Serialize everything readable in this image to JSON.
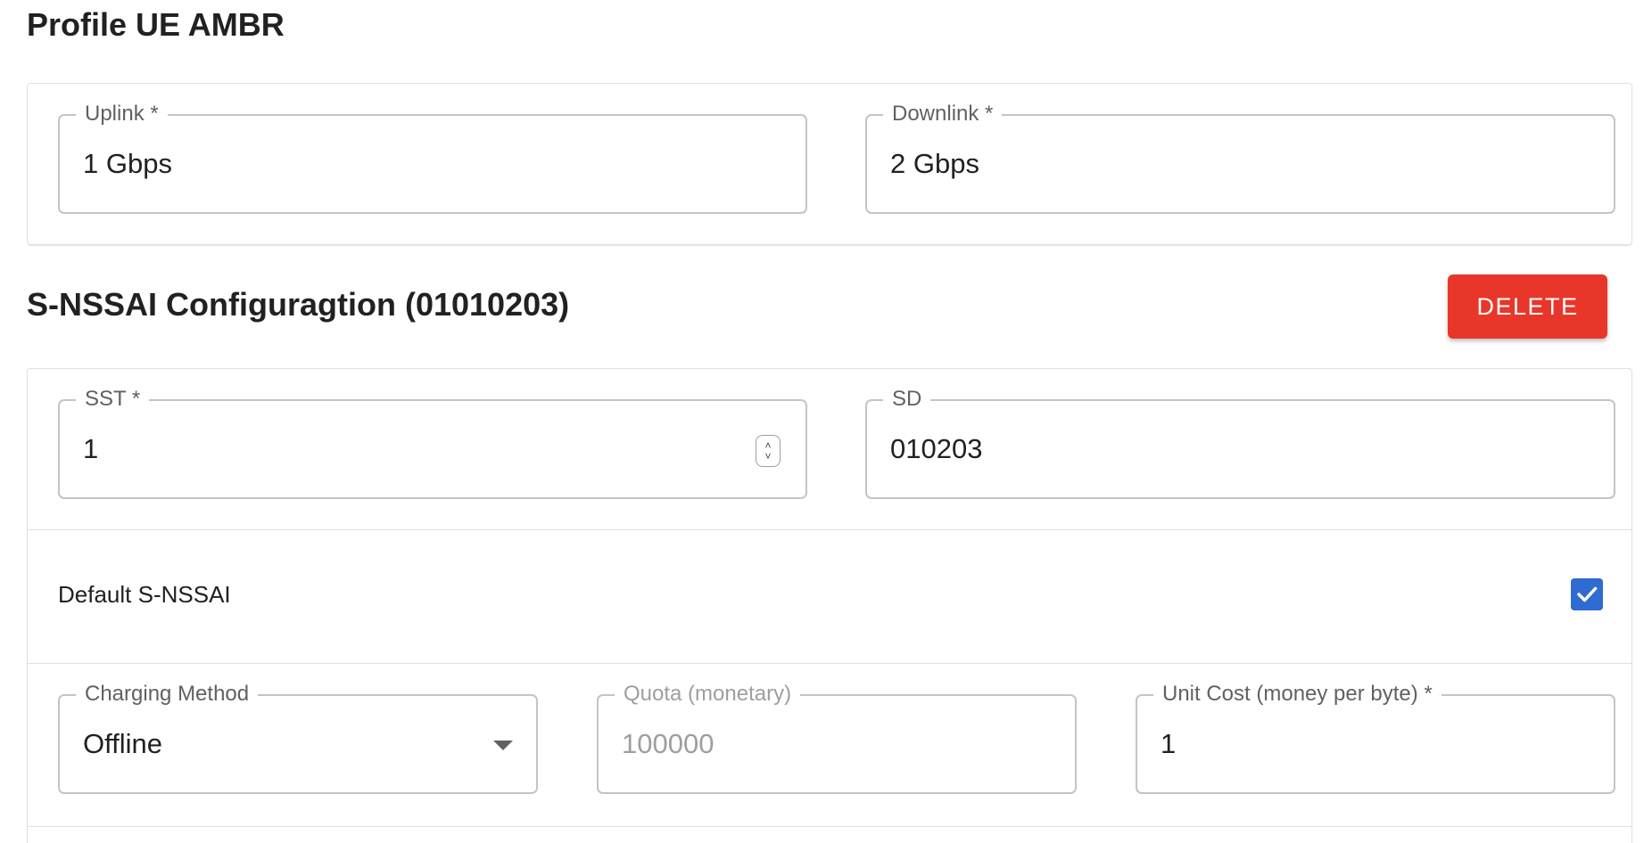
{
  "ambr": {
    "title": "Profile UE AMBR",
    "uplink": {
      "label": "Uplink *",
      "value": "1 Gbps"
    },
    "downlink": {
      "label": "Downlink *",
      "value": "2 Gbps"
    }
  },
  "snssai": {
    "title": "S-NSSAI Configuragtion (01010203)",
    "delete_label": "DELETE",
    "sst": {
      "label": "SST *",
      "value": "1"
    },
    "sd": {
      "label": "SD",
      "value": "010203"
    },
    "default_label": "Default S-NSSAI",
    "default_checked": true,
    "charging_method": {
      "label": "Charging Method",
      "value": "Offline"
    },
    "quota": {
      "label": "Quota (monetary)",
      "value": "100000",
      "disabled": true
    },
    "unit_cost": {
      "label": "Unit Cost (money per byte) *",
      "value": "1"
    }
  },
  "colors": {
    "delete": "#e8372a",
    "checkbox": "#2f6bd0"
  },
  "icons": [
    "spin-arrows-icon",
    "dropdown-caret-icon",
    "checkmark-icon"
  ]
}
